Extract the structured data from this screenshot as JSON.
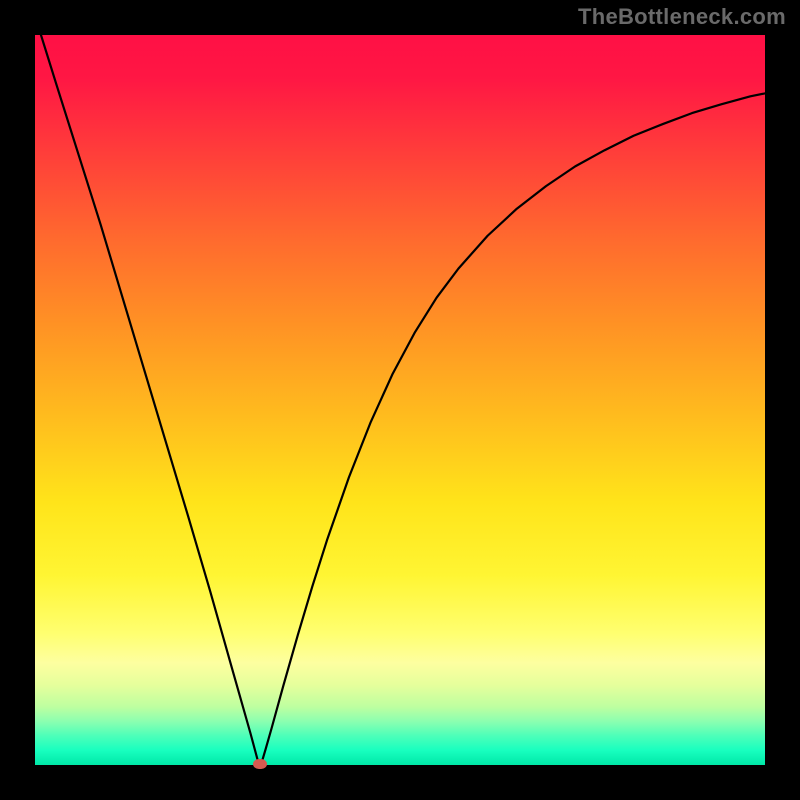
{
  "watermark": "TheBottleneck.com",
  "chart_data": {
    "type": "line",
    "title": "",
    "xlabel": "",
    "ylabel": "",
    "xlim": [
      0,
      1
    ],
    "ylim": [
      0,
      1
    ],
    "marker": {
      "x": 0.308,
      "y": 0.0
    },
    "curve_points": [
      {
        "x": 0.0082,
        "y": 1.0
      },
      {
        "x": 0.03,
        "y": 0.93
      },
      {
        "x": 0.06,
        "y": 0.835
      },
      {
        "x": 0.09,
        "y": 0.74
      },
      {
        "x": 0.12,
        "y": 0.64
      },
      {
        "x": 0.15,
        "y": 0.54
      },
      {
        "x": 0.18,
        "y": 0.44
      },
      {
        "x": 0.21,
        "y": 0.34
      },
      {
        "x": 0.24,
        "y": 0.238
      },
      {
        "x": 0.27,
        "y": 0.132
      },
      {
        "x": 0.295,
        "y": 0.044
      },
      {
        "x": 0.302,
        "y": 0.018
      },
      {
        "x": 0.306,
        "y": 0.003
      },
      {
        "x": 0.308,
        "y": 0.0
      },
      {
        "x": 0.311,
        "y": 0.005
      },
      {
        "x": 0.316,
        "y": 0.022
      },
      {
        "x": 0.324,
        "y": 0.05
      },
      {
        "x": 0.34,
        "y": 0.108
      },
      {
        "x": 0.36,
        "y": 0.178
      },
      {
        "x": 0.38,
        "y": 0.245
      },
      {
        "x": 0.4,
        "y": 0.308
      },
      {
        "x": 0.43,
        "y": 0.394
      },
      {
        "x": 0.46,
        "y": 0.47
      },
      {
        "x": 0.49,
        "y": 0.536
      },
      {
        "x": 0.52,
        "y": 0.592
      },
      {
        "x": 0.55,
        "y": 0.64
      },
      {
        "x": 0.58,
        "y": 0.68
      },
      {
        "x": 0.62,
        "y": 0.725
      },
      {
        "x": 0.66,
        "y": 0.762
      },
      {
        "x": 0.7,
        "y": 0.793
      },
      {
        "x": 0.74,
        "y": 0.82
      },
      {
        "x": 0.78,
        "y": 0.842
      },
      {
        "x": 0.82,
        "y": 0.862
      },
      {
        "x": 0.86,
        "y": 0.878
      },
      {
        "x": 0.9,
        "y": 0.893
      },
      {
        "x": 0.94,
        "y": 0.905
      },
      {
        "x": 0.98,
        "y": 0.916
      },
      {
        "x": 1.0,
        "y": 0.92
      }
    ],
    "gradient_stops": [
      {
        "pos": 0.0,
        "color": "#ff1045"
      },
      {
        "pos": 0.5,
        "color": "#ffd23a"
      },
      {
        "pos": 0.85,
        "color": "#ffff80"
      },
      {
        "pos": 1.0,
        "color": "#00e8a8"
      }
    ]
  }
}
